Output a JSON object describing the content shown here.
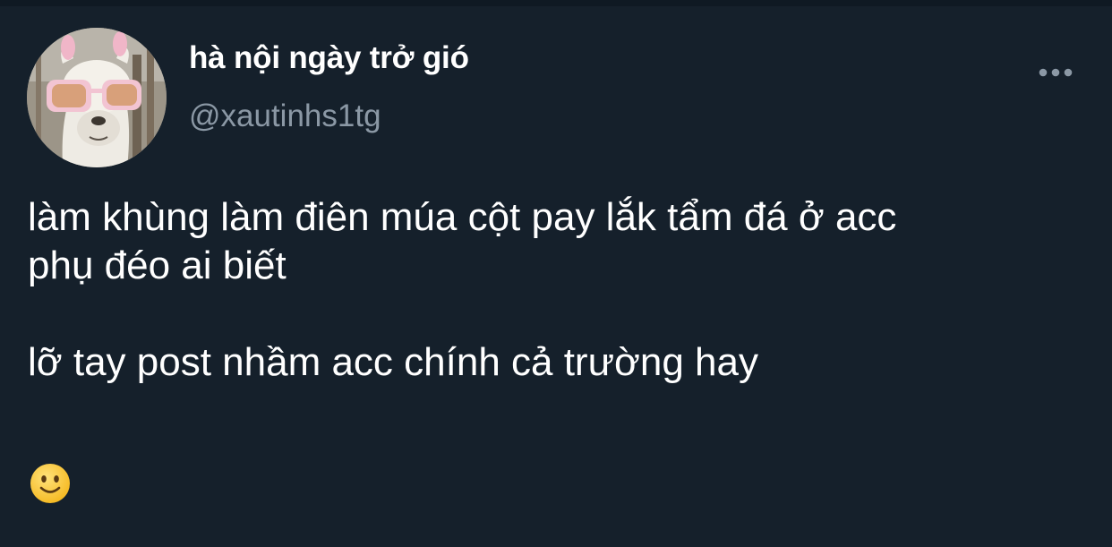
{
  "tweet": {
    "author": {
      "display_name": "hà nội ngày trở gió",
      "handle": "@xautinhs1tg",
      "avatar_icon": "alpaca-with-pink-sunglasses-avatar"
    },
    "more_icon": "more-options-icon",
    "text_lines": [
      "làm khùng làm điên múa cột pay lắk tẩm đá ở acc",
      "phụ đéo ai biết",
      "lỡ tay post nhầm acc chính cả trường hay"
    ],
    "emoji_icon": "slightly-smiling-face-emoji"
  },
  "colors": {
    "background": "#15202b",
    "primary_text": "#ffffff",
    "secondary_text": "#8b98a5"
  }
}
